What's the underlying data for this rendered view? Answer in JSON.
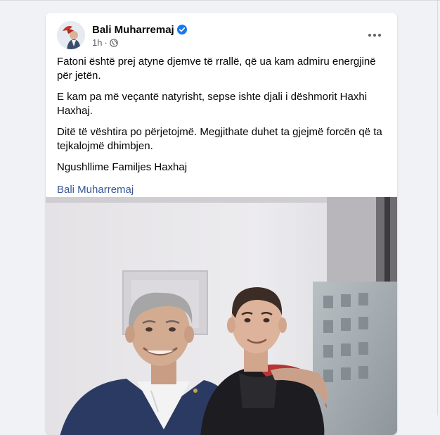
{
  "post": {
    "author": "Bali Muharremaj",
    "verified_icon": "verified-badge-icon",
    "time": "1h",
    "separator": "·",
    "audience_icon": "globe-icon",
    "more_icon": "more-options-icon",
    "paragraphs": [
      "Fatoni është prej atyne djemve të rrallë, që ua kam admiru energjinë për jetën.",
      "E kam pa më veçantë natyrisht, sepse ishte djali i dëshmorit Haxhi Haxhaj.",
      "Ditë të vështira po përjetojmë. Megjithate duhet ta gjejmë forcën që ta tejkalojmë dhimbjen.",
      "Ngushllime Familjes Haxhaj"
    ],
    "author_link": "Bali Muharremaj"
  },
  "colors": {
    "background": "#f0f2f5",
    "card": "#ffffff",
    "text": "#050505",
    "secondary_text": "#65676b",
    "link": "#385898",
    "verified": "#1877f2"
  }
}
